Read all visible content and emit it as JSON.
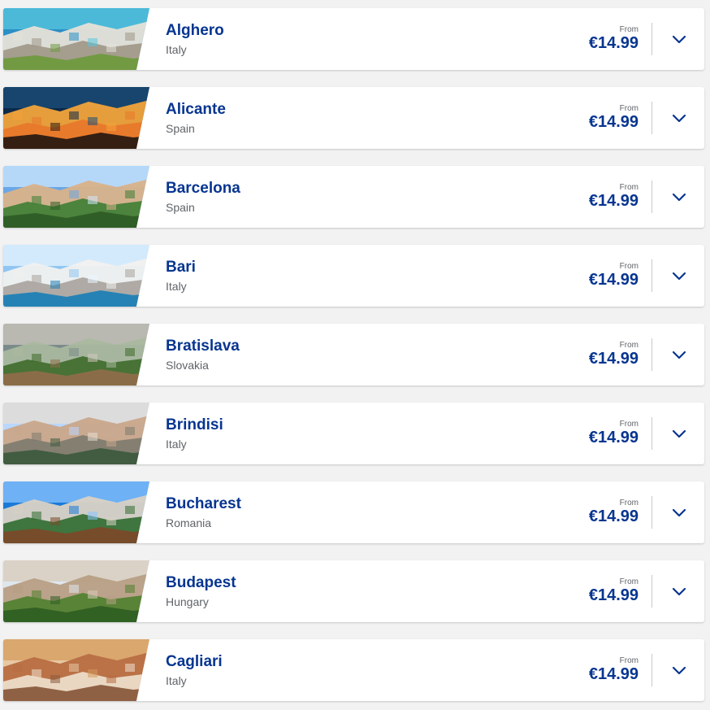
{
  "destinations": [
    {
      "city": "Alghero",
      "country": "Italy",
      "from_label": "From",
      "price": "€14.99",
      "image": "coastal-rocks-sea",
      "palette": [
        "#2a8fc7",
        "#58c7de",
        "#e6e2d8",
        "#9f9686",
        "#6f9a3f"
      ]
    },
    {
      "city": "Alicante",
      "country": "Spain",
      "from_label": "From",
      "price": "€14.99",
      "image": "night-harbor",
      "palette": [
        "#0c2a4a",
        "#1b4f7a",
        "#f2a33a",
        "#e8772b",
        "#2b1a12"
      ]
    },
    {
      "city": "Barcelona",
      "country": "Spain",
      "from_label": "From",
      "price": "€14.99",
      "image": "park-guell",
      "palette": [
        "#6aa7e6",
        "#cfe8ff",
        "#d9b28a",
        "#3d7d34",
        "#2d5d25"
      ]
    },
    {
      "city": "Bari",
      "country": "Italy",
      "from_label": "From",
      "price": "€14.99",
      "image": "white-cliff-houses",
      "palette": [
        "#8fc6f4",
        "#e9f6ff",
        "#f1f1ef",
        "#a8a29c",
        "#1f7fb5"
      ]
    },
    {
      "city": "Bratislava",
      "country": "Slovakia",
      "from_label": "From",
      "price": "€14.99",
      "image": "old-town-greenery",
      "palette": [
        "#7a8b8a",
        "#cfc7bd",
        "#a9b89f",
        "#3e6a2a",
        "#8e6d4a"
      ]
    },
    {
      "city": "Brindisi",
      "country": "Italy",
      "from_label": "From",
      "price": "€14.99",
      "image": "waterfront-buildings",
      "palette": [
        "#b9d7ff",
        "#e8ded1",
        "#c9a78a",
        "#7c7a6e",
        "#3e5b3e"
      ]
    },
    {
      "city": "Bucharest",
      "country": "Romania",
      "from_label": "From",
      "price": "€14.99",
      "image": "castle-forest",
      "palette": [
        "#1a7ad8",
        "#8bc4ff",
        "#d9d2c4",
        "#2f6b2f",
        "#7a4a2a"
      ]
    },
    {
      "city": "Budapest",
      "country": "Hungary",
      "from_label": "From",
      "price": "€14.99",
      "image": "fisherman-bastion",
      "palette": [
        "#dfe7ee",
        "#d8cbb9",
        "#b79f84",
        "#4f7f2d",
        "#2f5f22"
      ]
    },
    {
      "city": "Cagliari",
      "country": "Italy",
      "from_label": "From",
      "price": "€14.99",
      "image": "rooftop-city",
      "palette": [
        "#e7c9a3",
        "#d59b5c",
        "#b86e42",
        "#f0e2cf",
        "#8a5b3d"
      ]
    }
  ],
  "expand_icon": "chevron-down-icon"
}
